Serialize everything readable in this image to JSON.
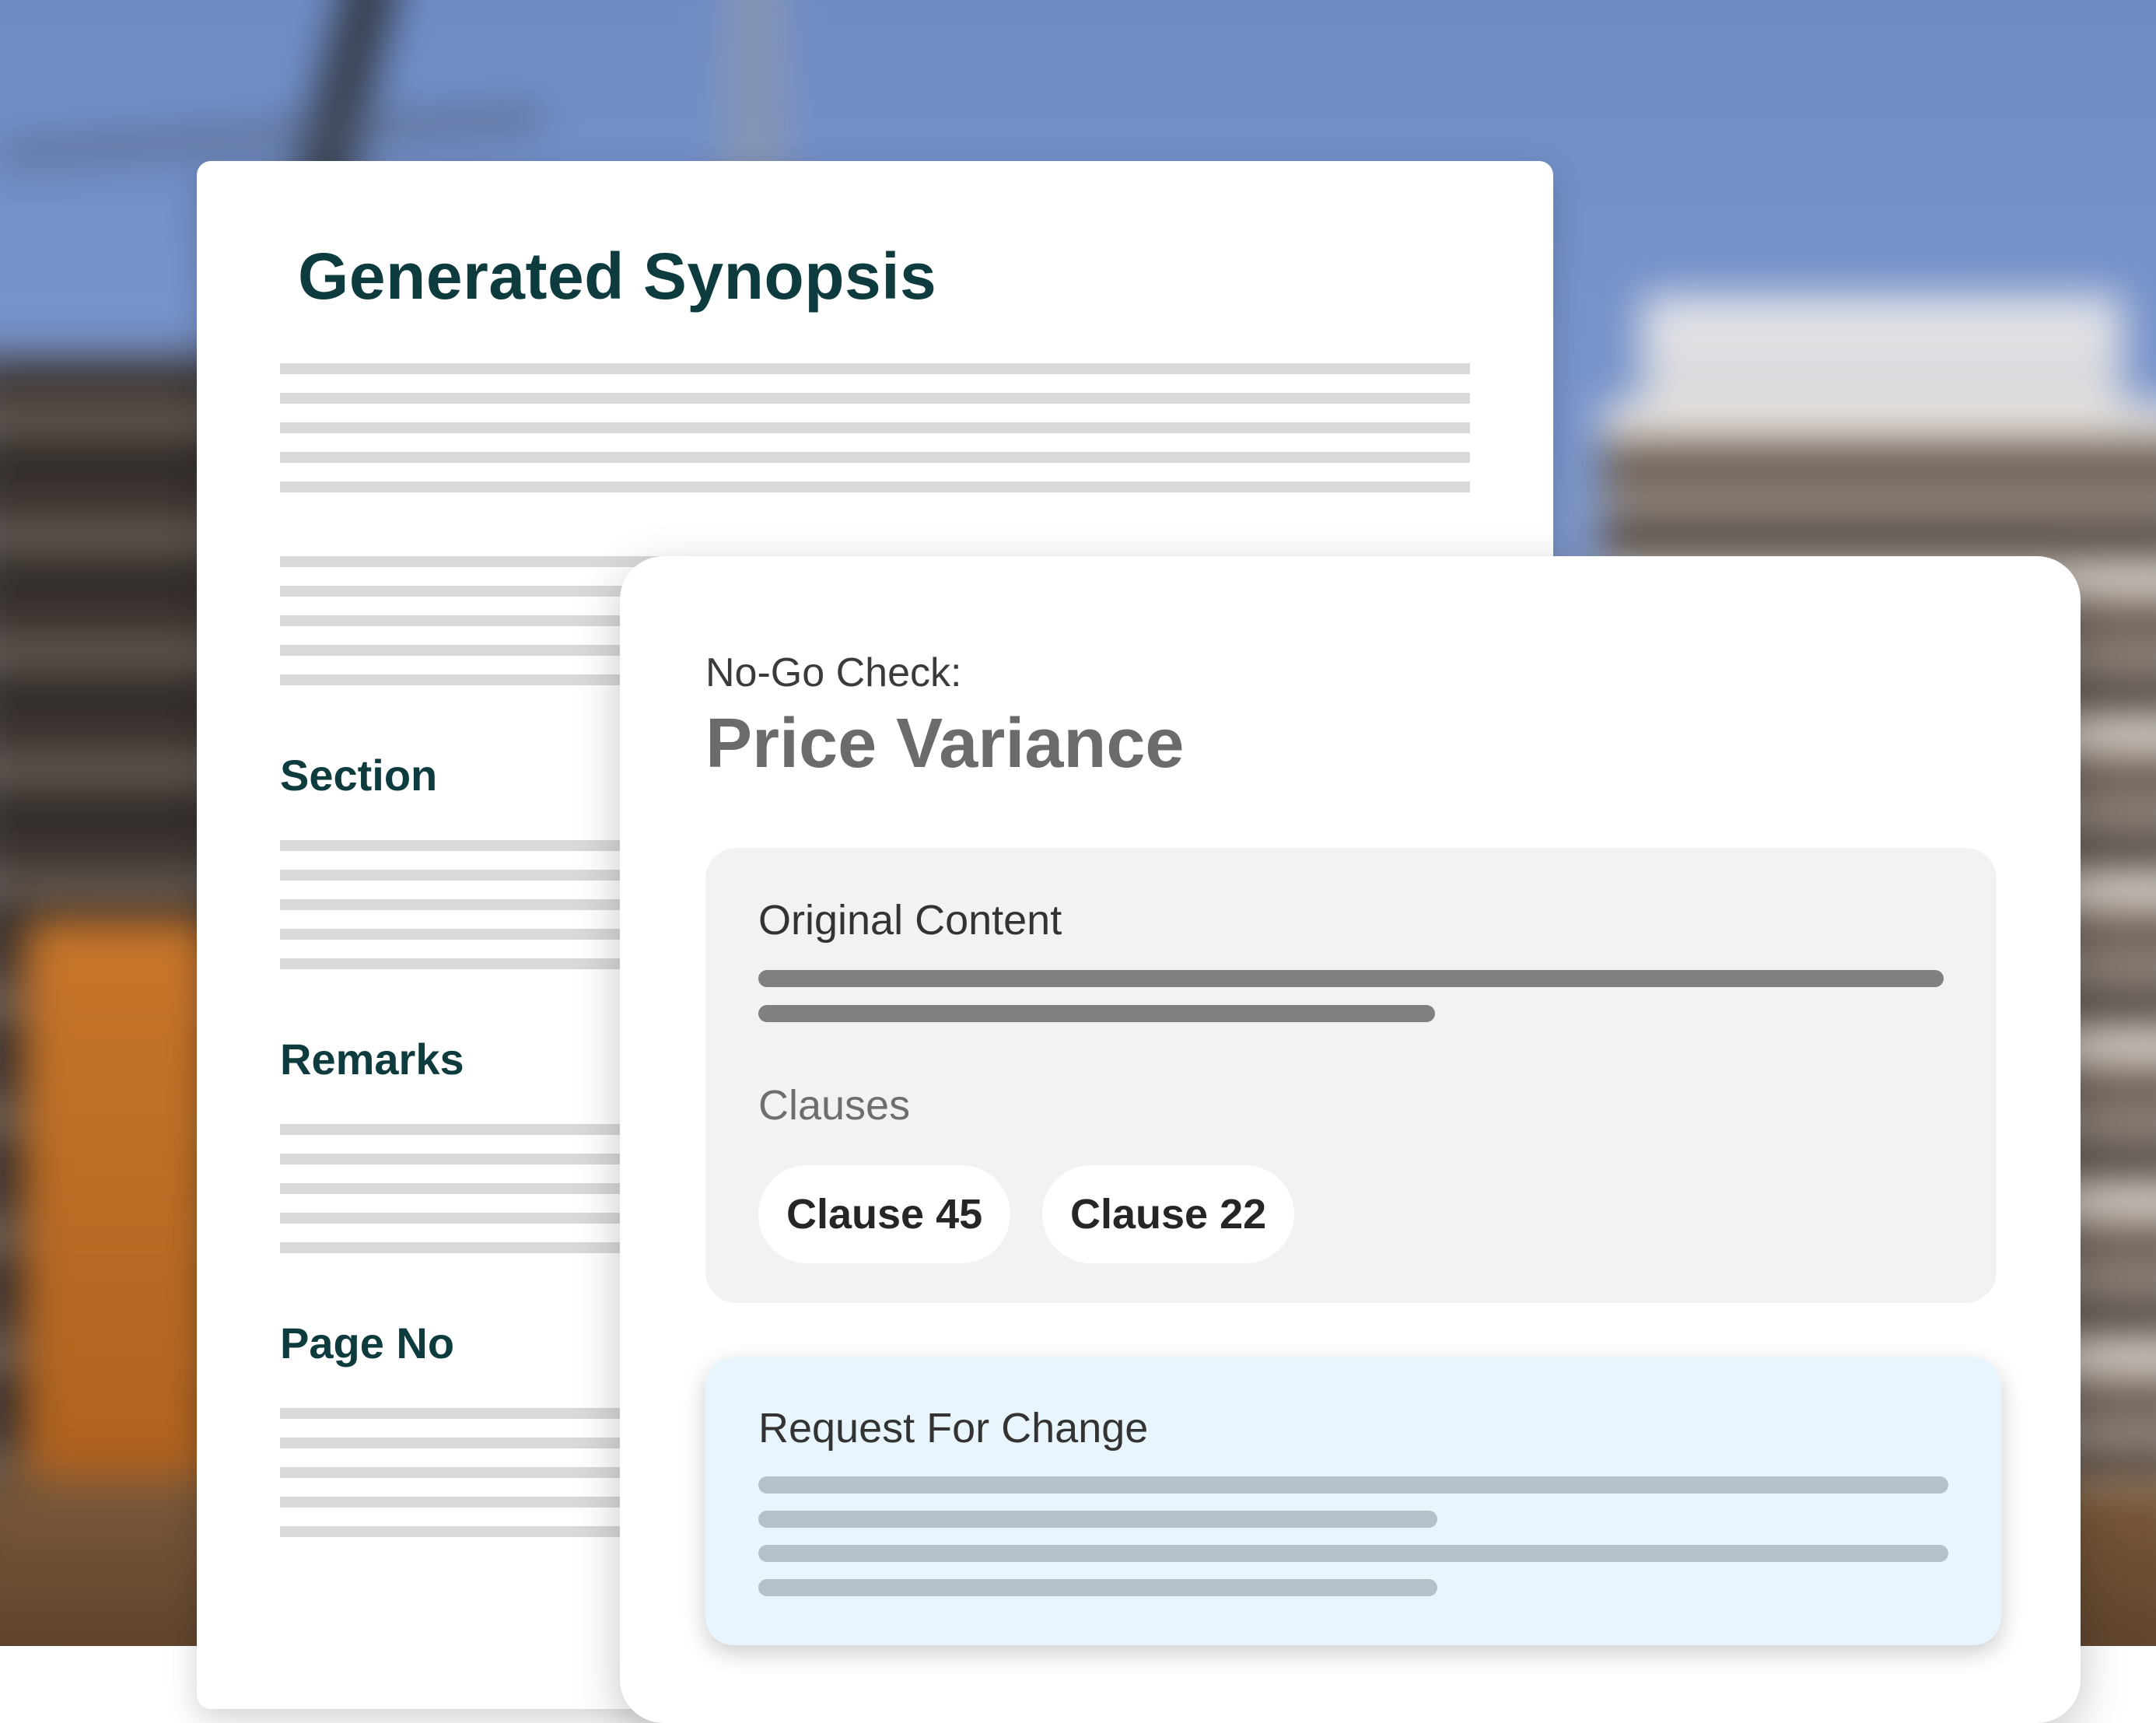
{
  "document": {
    "title": "Generated Synopsis",
    "sections": [
      {
        "label": "Section"
      },
      {
        "label": "Remarks"
      },
      {
        "label": "Page No"
      }
    ]
  },
  "nogo_check": {
    "kicker": "No-Go Check:",
    "title": "Price Variance",
    "original_content": {
      "heading": "Original Content",
      "clauses_label": "Clauses",
      "clauses": [
        "Clause 45",
        "Clause 22"
      ]
    },
    "request_for_change": {
      "heading": "Request For Change"
    }
  },
  "colors": {
    "heading_teal": "#0d3b3e",
    "title_gray": "#6b6b6b",
    "panel_gray": "#f2f2f2",
    "rfc_blue": "#e9f5fd",
    "placeholder_line": "#d9d9d9"
  }
}
